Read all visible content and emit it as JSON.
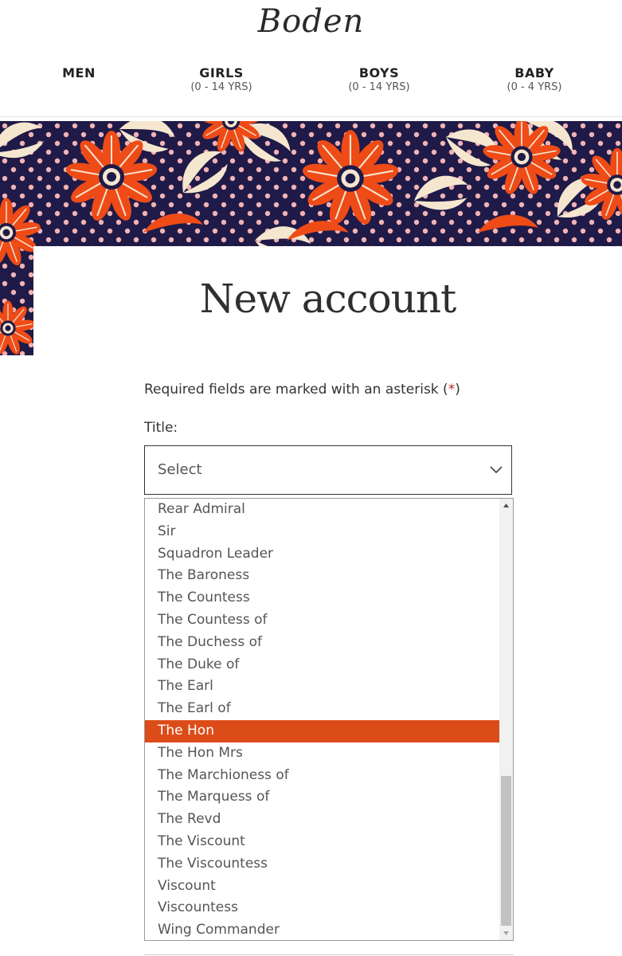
{
  "brand": {
    "logo_text": "Boden"
  },
  "nav": [
    {
      "label": "MEN",
      "sub": ""
    },
    {
      "label": "GIRLS",
      "sub": "(0 - 14 YRS)"
    },
    {
      "label": "BOYS",
      "sub": "(0 - 14 YRS)"
    },
    {
      "label": "BABY",
      "sub": "(0 - 4 YRS)"
    }
  ],
  "page": {
    "heading": "New account"
  },
  "form": {
    "required_note": "Required fields are marked with an asterisk (",
    "required_star": "*",
    "required_close": ")",
    "title_label": "Title:",
    "title_select_value": "Select"
  },
  "dropdown": {
    "options": [
      "Rear Admiral",
      "Sir",
      "Squadron Leader",
      "The Baroness",
      "The Countess",
      "The Countess of",
      "The Duchess of",
      "The Duke of",
      "The Earl",
      "The Earl of",
      "The Hon",
      "The Hon Mrs",
      "The Marchioness of",
      "The Marquess of",
      "The Revd",
      "The Viscount",
      "The Viscountess",
      "Viscount",
      "Viscountess",
      "Wing Commander"
    ],
    "highlighted": "The Hon",
    "scroll_position": 0.9
  },
  "colors": {
    "highlight": "#dc4c19",
    "pattern_navy": "#1f1a47",
    "pattern_orange": "#ef4b17",
    "pattern_cream": "#f5e6cf",
    "pattern_pink": "#f2b3b5",
    "required_star": "#c41e1e"
  }
}
